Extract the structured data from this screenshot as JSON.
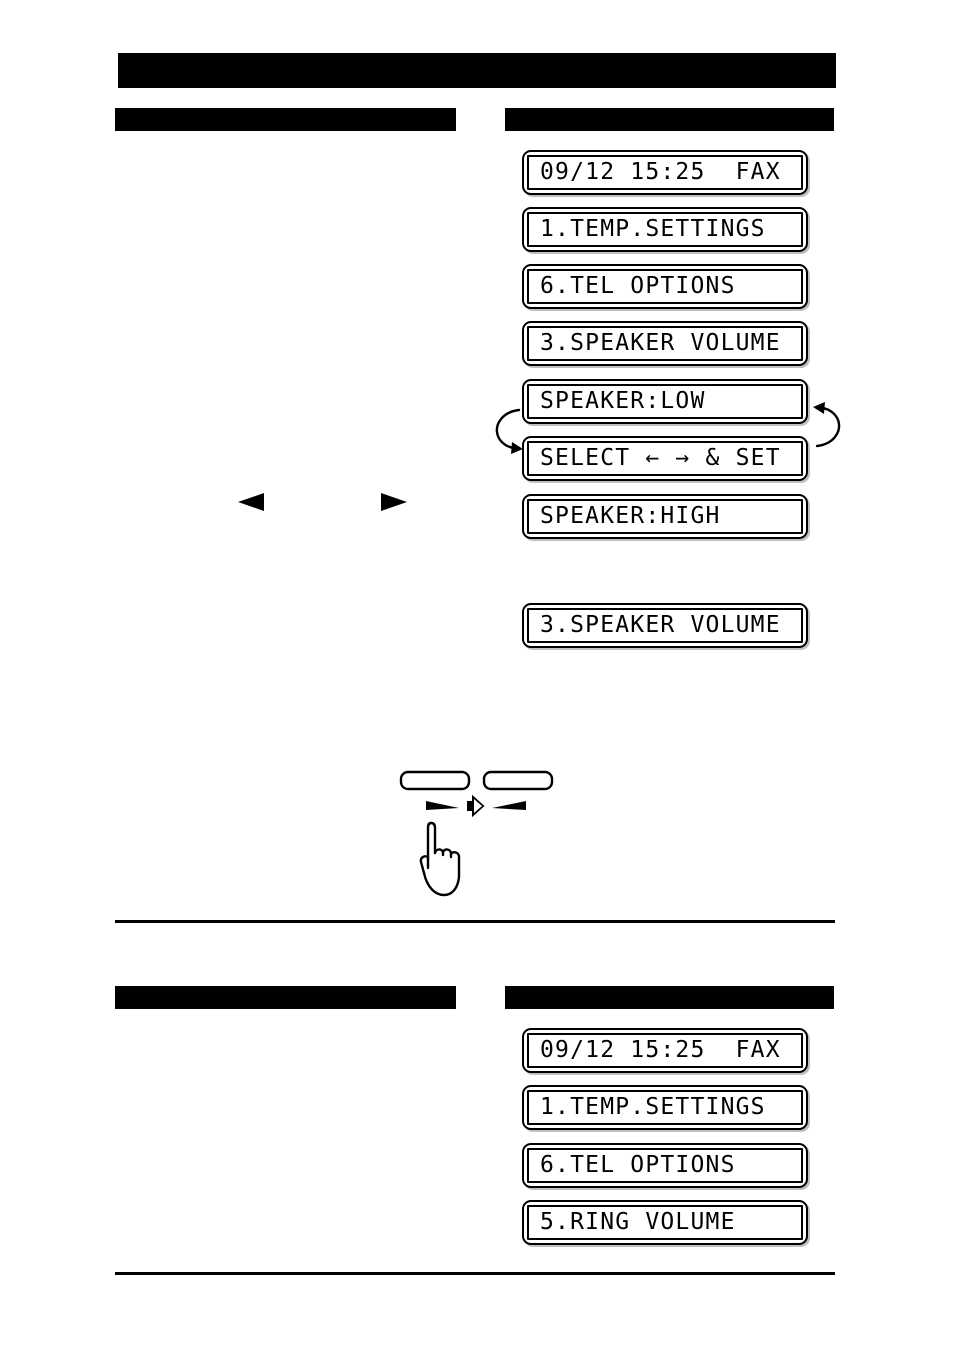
{
  "document": {
    "redacted_header": {
      "title_bar": "",
      "note": "solid black redaction bars; no legible text"
    }
  },
  "sections": [
    {
      "id": "speaker-volume",
      "heading_left": "",
      "heading_right": "",
      "lcd_steps": [
        {
          "id": "standby",
          "text": "09/12 15:25  FAX"
        },
        {
          "id": "menu-1",
          "text": "1.TEMP.SETTINGS"
        },
        {
          "id": "menu-6",
          "text": "6.TEL OPTIONS"
        },
        {
          "id": "menu-3",
          "text": "3.SPEAKER VOLUME"
        },
        {
          "id": "speaker-low",
          "text": "SPEAKER:LOW"
        },
        {
          "id": "select-set",
          "text": "SELECT ← → & SET"
        },
        {
          "id": "speaker-high",
          "text": "SPEAKER:HIGH"
        }
      ],
      "lcd_result": {
        "id": "menu-3-result",
        "text": "3.SPEAKER VOLUME"
      },
      "nav_keys": [
        {
          "id": "left-arrow-key",
          "glyph": "◀",
          "name": "left-arrow-key"
        },
        {
          "id": "right-arrow-key",
          "glyph": "▶",
          "name": "right-arrow-key"
        }
      ],
      "loop_arrows": [
        {
          "id": "loop-left",
          "direction": "counterclockwise"
        },
        {
          "id": "loop-right",
          "direction": "clockwise"
        }
      ],
      "illustration": {
        "id": "volume-keys-illustration",
        "buttons": [
          {
            "id": "volume-down-button",
            "label": ""
          },
          {
            "id": "volume-up-button",
            "label": ""
          }
        ],
        "speaker_icon": "speaker-icon",
        "wedges": [
          {
            "id": "volume-decrease-wedge"
          },
          {
            "id": "volume-increase-wedge"
          }
        ],
        "hand": "pointing-hand-icon"
      }
    },
    {
      "id": "ring-volume",
      "heading_left": "",
      "heading_right": "",
      "lcd_steps": [
        {
          "id": "standby-2",
          "text": "09/12 15:25  FAX"
        },
        {
          "id": "menu-1-b",
          "text": "1.TEMP.SETTINGS"
        },
        {
          "id": "menu-6-b",
          "text": "6.TEL OPTIONS"
        },
        {
          "id": "menu-5-b",
          "text": "5.RING VOLUME"
        }
      ]
    }
  ],
  "colors": {
    "ink": "#000000",
    "paper": "#ffffff",
    "lcd_shadow": "#bfbfbf"
  }
}
